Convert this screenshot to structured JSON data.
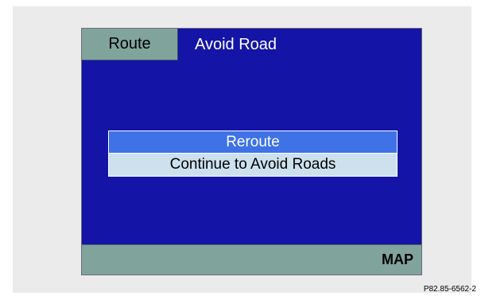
{
  "screen": {
    "route_tab": "Route",
    "title": "Avoid Road",
    "menu": {
      "items": [
        {
          "label": "Reroute",
          "selected": true
        },
        {
          "label": "Continue to Avoid Roads",
          "selected": false
        }
      ]
    },
    "softkey_right": "MAP"
  },
  "figure_id": "P82.85-6562-2",
  "colors": {
    "screen_bg": "#1414a6",
    "bar_bg": "#80a49c",
    "selected_bg": "#3e72e6",
    "item_bg": "#cde0ee"
  }
}
